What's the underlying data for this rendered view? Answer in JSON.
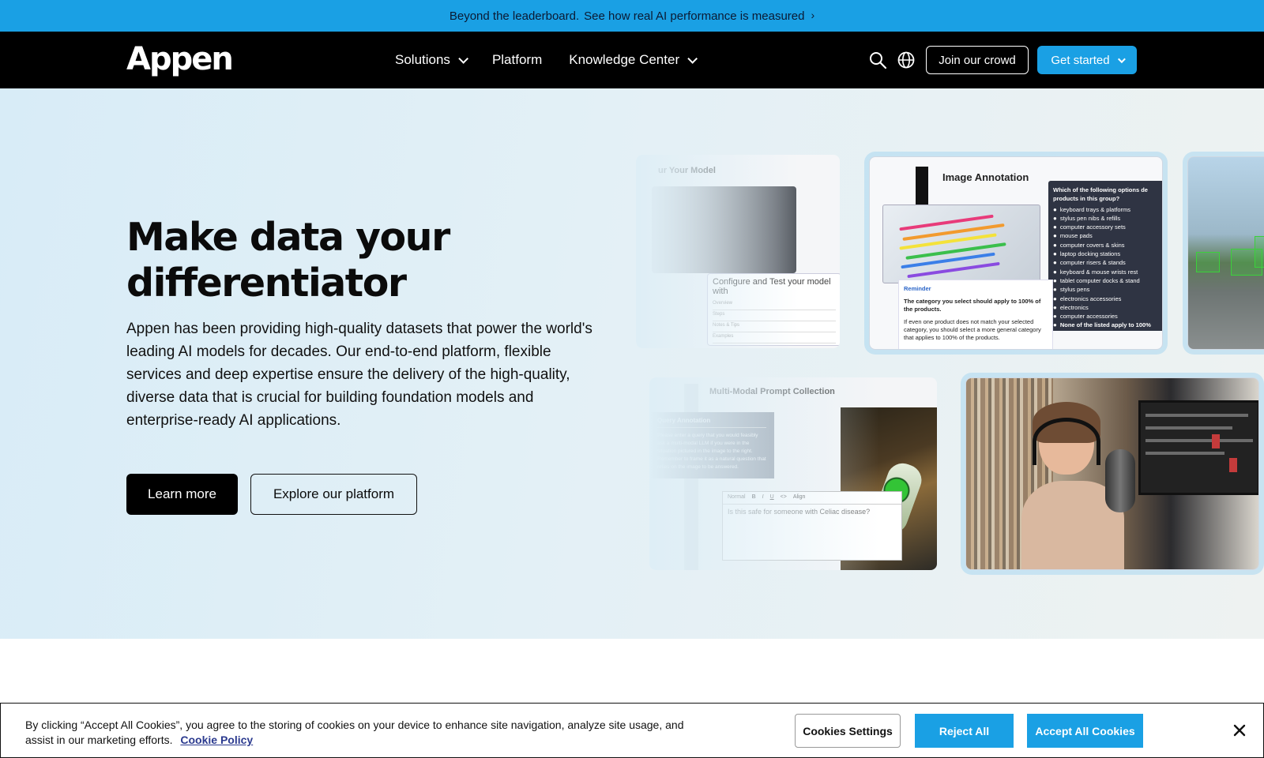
{
  "announcement": {
    "lead": "Beyond the leaderboard.",
    "link": "See how real AI performance is measured"
  },
  "header": {
    "logo": "Appen",
    "nav": [
      {
        "label": "Solutions",
        "has_dropdown": true
      },
      {
        "label": "Platform",
        "has_dropdown": false
      },
      {
        "label": "Knowledge Center",
        "has_dropdown": true
      }
    ],
    "join_label": "Join our crowd",
    "get_started_label": "Get started"
  },
  "hero": {
    "title": "Make data your differentiator",
    "description": "Appen has been providing high-quality datasets that power the world's leading AI models for decades. Our end-to-end platform, flexible services and deep expertise ensure the delivery of the high-quality, diverse data that is crucial for building foundation models and enterprise-ready AI applications.",
    "learn_more": "Learn more",
    "explore": "Explore our platform"
  },
  "cards": {
    "configure": {
      "title": "ur Your Model",
      "panel_title": "Configure and Test your model with",
      "rows": [
        "Overview",
        "Steps",
        "Notes & Tips",
        "Examples"
      ]
    },
    "image_annotation": {
      "title": "Image Annotation",
      "question": "Which of the following options de products in this group?",
      "options": [
        "keyboard trays & platforms",
        "stylus pen nibs & refills",
        "computer accessory sets",
        "mouse pads",
        "computer covers & skins",
        "laptop docking stations",
        "computer risers & stands",
        "keyboard & mouse wrists rest",
        "tablet computer docks & stand",
        "stylus pens",
        "electronics accessories",
        "electronics",
        "computer accessories",
        "None of the listed apply to 100%"
      ],
      "reminder_title": "Reminder",
      "reminder_text": "The category you select should apply to 100% of the products.",
      "reminder_note": "If even one product does not match your selected category, you should select a more general category that applies to 100% of the products."
    },
    "multimodal": {
      "title": "Multi-Modal Prompt Collection",
      "query_title": "Query Annotation",
      "query_text": "Please enter a query that you would feasibly ask a multi-modal LLM if you were in the situation pictured in the image to the right. Remember to frame it as a natural question that relies on the image to be answered.",
      "editor_text": "Is this safe for someone with Celiac disease?",
      "toolbar": [
        "Normal",
        "B",
        "I",
        "U",
        "<>",
        "Align"
      ]
    }
  },
  "cookie": {
    "message": "By clicking “Accept All Cookies”, you agree to the storing of cookies on your device to enhance site navigation, analyze site usage, and assist in our marketing efforts.",
    "policy": "Cookie Policy",
    "settings": "Cookies Settings",
    "reject": "Reject All",
    "accept": "Accept All Cookies"
  },
  "colors": {
    "brand_blue": "#1aa0e4",
    "header_bg": "#000000",
    "hero_bg": "#d8ecf7"
  },
  "icons": {
    "search": "search-icon",
    "globe": "globe-icon",
    "close": "close-icon",
    "chevron": "chevron-down-icon"
  }
}
